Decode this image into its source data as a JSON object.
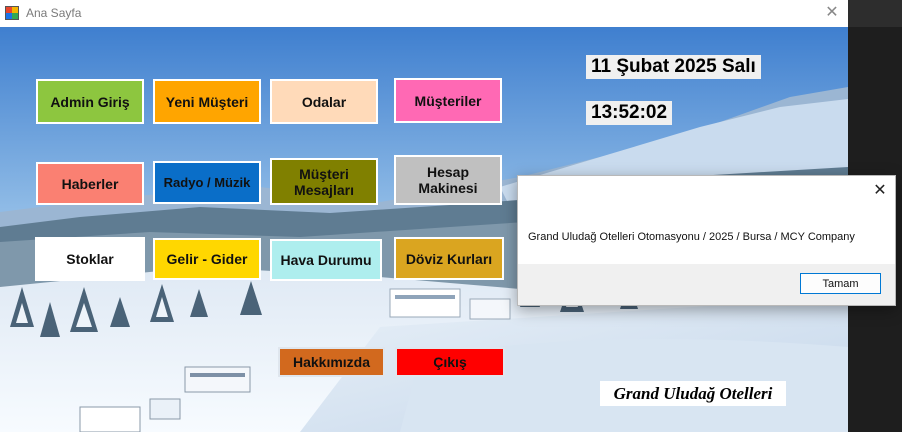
{
  "window": {
    "title": "Ana Sayfa",
    "close_glyph": "✕"
  },
  "buttons": {
    "admin": {
      "label": "Admin Giriş",
      "color": "#8dc63f"
    },
    "new_customer": {
      "label": "Yeni Müşteri",
      "color": "#ffa500"
    },
    "rooms": {
      "label": "Odalar",
      "color": "#ffdab9"
    },
    "customers": {
      "label": "Müşteriler",
      "color": "#ff69b4"
    },
    "news": {
      "label": "Haberler",
      "color": "#fa8072"
    },
    "radio": {
      "label": "Radyo / Müzik",
      "color": "#0a6ec8"
    },
    "messages_line1": "Müşteri",
    "messages_line2": "Mesajları",
    "messages_color": "#808000",
    "calc_line1": "Hesap",
    "calc_line2": "Makinesi",
    "calc_color": "#c0c0c0",
    "stocks": {
      "label": "Stoklar",
      "color": "#ffffff"
    },
    "income": {
      "label": "Gelir - Gider",
      "color": "#ffd700"
    },
    "weather": {
      "label": "Hava Durumu",
      "color": "#aeeeee"
    },
    "currency": {
      "label": "Döviz Kurları",
      "color": "#daa520"
    },
    "about": {
      "label": "Hakkımızda",
      "color": "#d2691e"
    },
    "exit": {
      "label": "Çıkış",
      "color": "#ff0000"
    }
  },
  "date_text": "11 Şubat 2025 Salı",
  "time_text": "13:52:02",
  "brand_text": "Grand Uludağ Otelleri",
  "dialog": {
    "close_glyph": "✕",
    "message": "Grand Uludağ Otelleri Otomasyonu / 2025 / Bursa / MCY Company",
    "ok_label": "Tamam"
  }
}
